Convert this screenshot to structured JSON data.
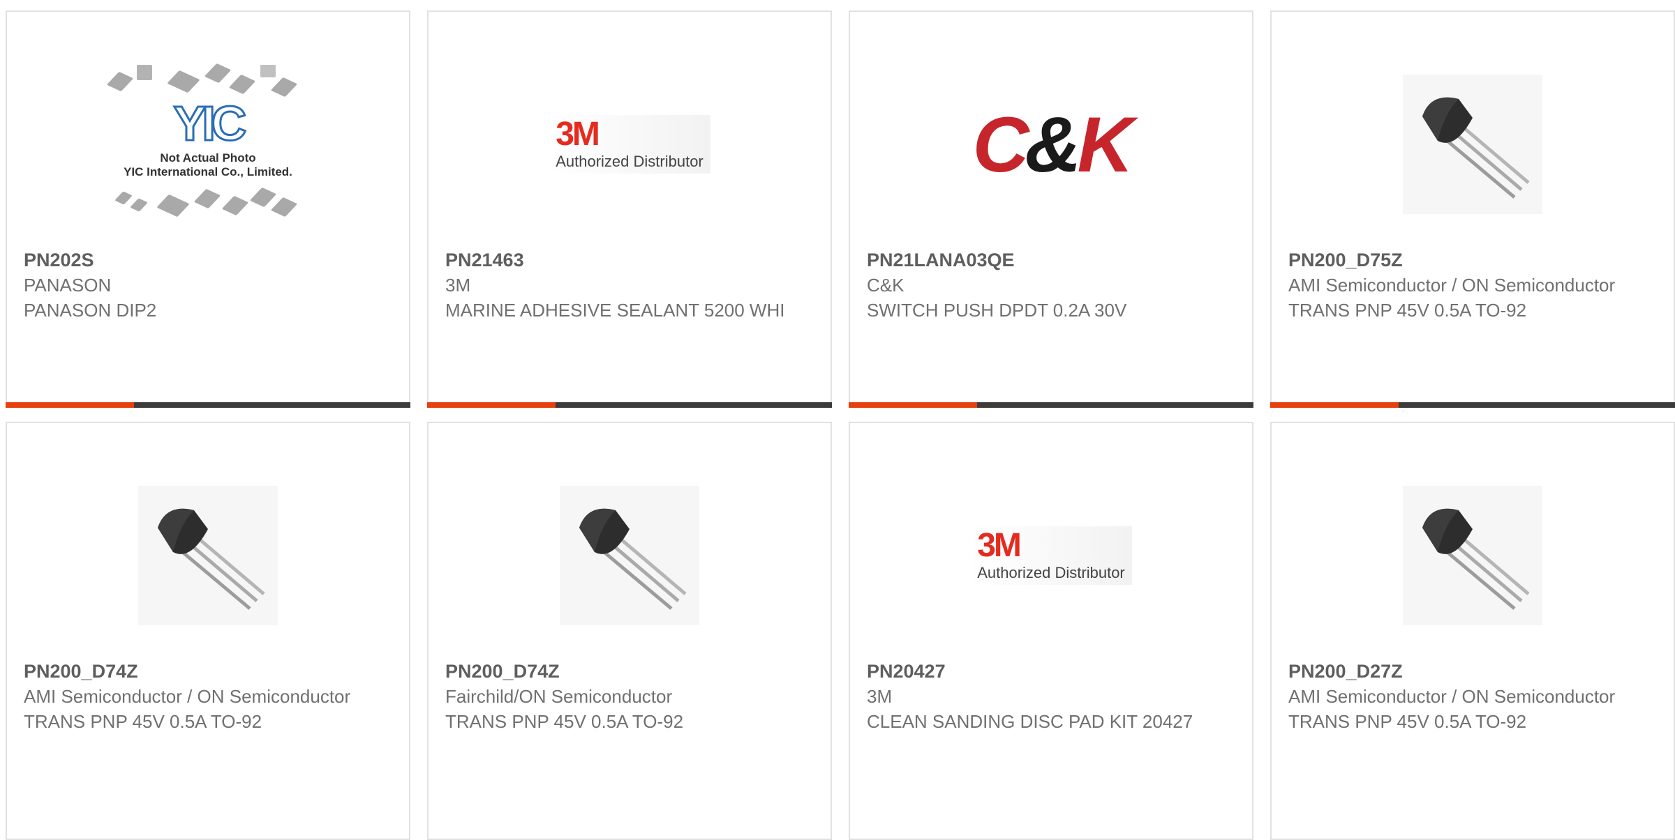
{
  "products": [
    {
      "part": "PN202S",
      "manufacturer": "PANASON",
      "description": "PANASON DIP2",
      "image": "yic-placeholder",
      "caption1": "Not Actual Photo",
      "caption2": "YIC International Co., Limited.",
      "logo_text": "YIC"
    },
    {
      "part": "PN21463",
      "manufacturer": "3M",
      "description": "MARINE ADHESIVE SEALANT 5200 WHI",
      "image": "3m-logo",
      "logo_text": "3M",
      "logo_sub": "Authorized Distributor"
    },
    {
      "part": "PN21LANA03QE",
      "manufacturer": "C&K",
      "description": "SWITCH PUSH DPDT 0.2A 30V",
      "image": "ck-logo",
      "logo_text_a": "C",
      "logo_text_amp": "&",
      "logo_text_b": "K"
    },
    {
      "part": "PN200_D75Z",
      "manufacturer": "AMI Semiconductor / ON Semiconductor",
      "description": "TRANS PNP 45V 0.5A TO-92",
      "image": "to92-transistor-icon"
    },
    {
      "part": "PN200_D74Z",
      "manufacturer": "AMI Semiconductor / ON Semiconductor",
      "description": "TRANS PNP 45V 0.5A TO-92",
      "image": "to92-transistor-icon"
    },
    {
      "part": "PN200_D74Z",
      "manufacturer": "Fairchild/ON Semiconductor",
      "description": "TRANS PNP 45V 0.5A TO-92",
      "image": "to92-transistor-icon"
    },
    {
      "part": "PN20427",
      "manufacturer": "3M",
      "description": "CLEAN SANDING DISC PAD KIT 20427",
      "image": "3m-logo",
      "logo_text": "3M",
      "logo_sub": "Authorized Distributor"
    },
    {
      "part": "PN200_D27Z",
      "manufacturer": "AMI Semiconductor / ON Semiconductor",
      "description": "TRANS PNP 45V 0.5A TO-92",
      "image": "to92-transistor-icon"
    }
  ],
  "colors": {
    "accent": "#e5400d",
    "bar": "#3b3b3b",
    "border": "#e1e1e1",
    "text": "#666666"
  }
}
